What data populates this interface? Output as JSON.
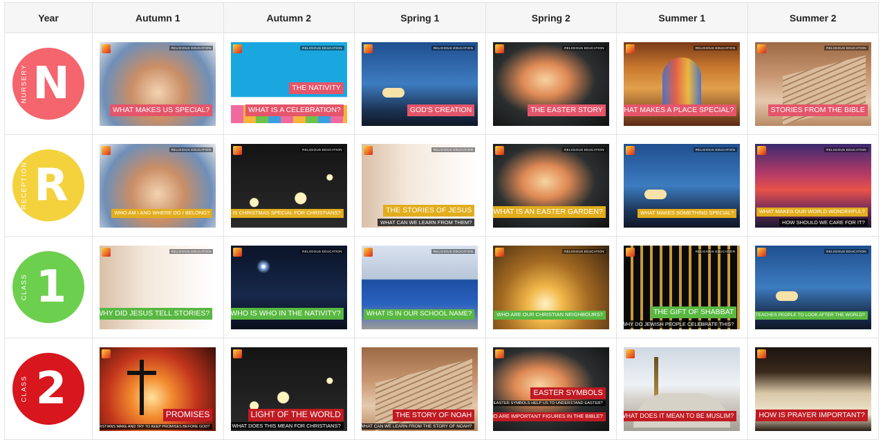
{
  "header": {
    "year": "Year",
    "terms": [
      "Autumn 1",
      "Autumn 2",
      "Spring 1",
      "Spring 2",
      "Summer 1",
      "Summer 2"
    ]
  },
  "tag_text": "RELIGIOUS EDUCATION",
  "rows": [
    {
      "badge": {
        "letter": "N",
        "label": "NURSERY",
        "color": "#f5656d"
      },
      "topics": [
        {
          "title": "WHAT MAKES US SPECIAL?",
          "subtitle": ""
        },
        {
          "title": "WHAT IS A CELEBRATION?",
          "subtitle": "",
          "extra": "THE NATIVITY"
        },
        {
          "title": "GOD'S CREATION",
          "subtitle": ""
        },
        {
          "title": "THE EASTER STORY",
          "subtitle": ""
        },
        {
          "title": "WHAT MAKES A PLACE SPECIAL?",
          "subtitle": ""
        },
        {
          "title": "STORIES FROM THE BIBLE",
          "subtitle": ""
        }
      ]
    },
    {
      "badge": {
        "letter": "R",
        "label": "RECEPTION",
        "color": "#f4d23e"
      },
      "topics": [
        {
          "title": "WHO AM I AND WHERE DO I BELONG?",
          "subtitle": ""
        },
        {
          "title": "WHY IS CHRISTMAS SPECIAL FOR CHRISTIANS?",
          "subtitle": ""
        },
        {
          "title": "THE STORIES OF JESUS",
          "subtitle": "WHAT CAN WE LEARN FROM THEM?"
        },
        {
          "title": "WHAT IS AN EASTER GARDEN?",
          "subtitle": ""
        },
        {
          "title": "WHAT MAKES SOMETHING SPECIAL?",
          "subtitle": ""
        },
        {
          "title": "WHAT MAKES OUR WORLD WONDERFUL?",
          "subtitle": "HOW SHOULD WE CARE FOR IT?"
        }
      ]
    },
    {
      "badge": {
        "letter": "1",
        "label": "CLASS",
        "color": "#6dcf4e"
      },
      "topics": [
        {
          "title": "WHY DID JESUS TELL STORIES?",
          "subtitle": ""
        },
        {
          "title": "WHO IS WHO IN THE NATIVITY?",
          "subtitle": ""
        },
        {
          "title": "WHAT IS IN OUR SCHOOL NAME?",
          "subtitle": ""
        },
        {
          "title": "WHO ARE OUR CHRISTIAN NEIGHBOURS?",
          "subtitle": ""
        },
        {
          "title": "THE GIFT OF SHABBAT",
          "subtitle": "WHY DO JEWISH PEOPLE CELEBRATE THIS?"
        },
        {
          "title": "WHAT TEACHES PEOPLE TO LOOK AFTER THE WORLD?",
          "subtitle": ""
        }
      ]
    },
    {
      "badge": {
        "letter": "2",
        "label": "CLASS",
        "color": "#d7161d"
      },
      "topics": [
        {
          "title": "PROMISES",
          "subtitle": "WHY DO CHRISTIANS MAKE AND TRY TO KEEP PROMISES BEFORE GOD?"
        },
        {
          "title": "LIGHT OF THE WORLD",
          "subtitle": "WHAT DOES THIS MEAN FOR CHRISTIANS?"
        },
        {
          "title": "THE STORY OF NOAH",
          "subtitle": "WHAT CAN WE LEARN FROM THE STORY OF NOAH?"
        },
        {
          "title": "EASTER SYMBOLS",
          "subtitle": "DO EASTER SYMBOLS HELP US TO UNDERSTAND EASTER?",
          "extra": "WHO ARE IMPORTANT FIGURES IN THE BIBLE?"
        },
        {
          "title": "WHAT DOES IT MEAN TO BE MUSLIM?",
          "subtitle": ""
        },
        {
          "title": "HOW IS PRAYER IMPORTANT?",
          "subtitle": ""
        }
      ]
    }
  ]
}
